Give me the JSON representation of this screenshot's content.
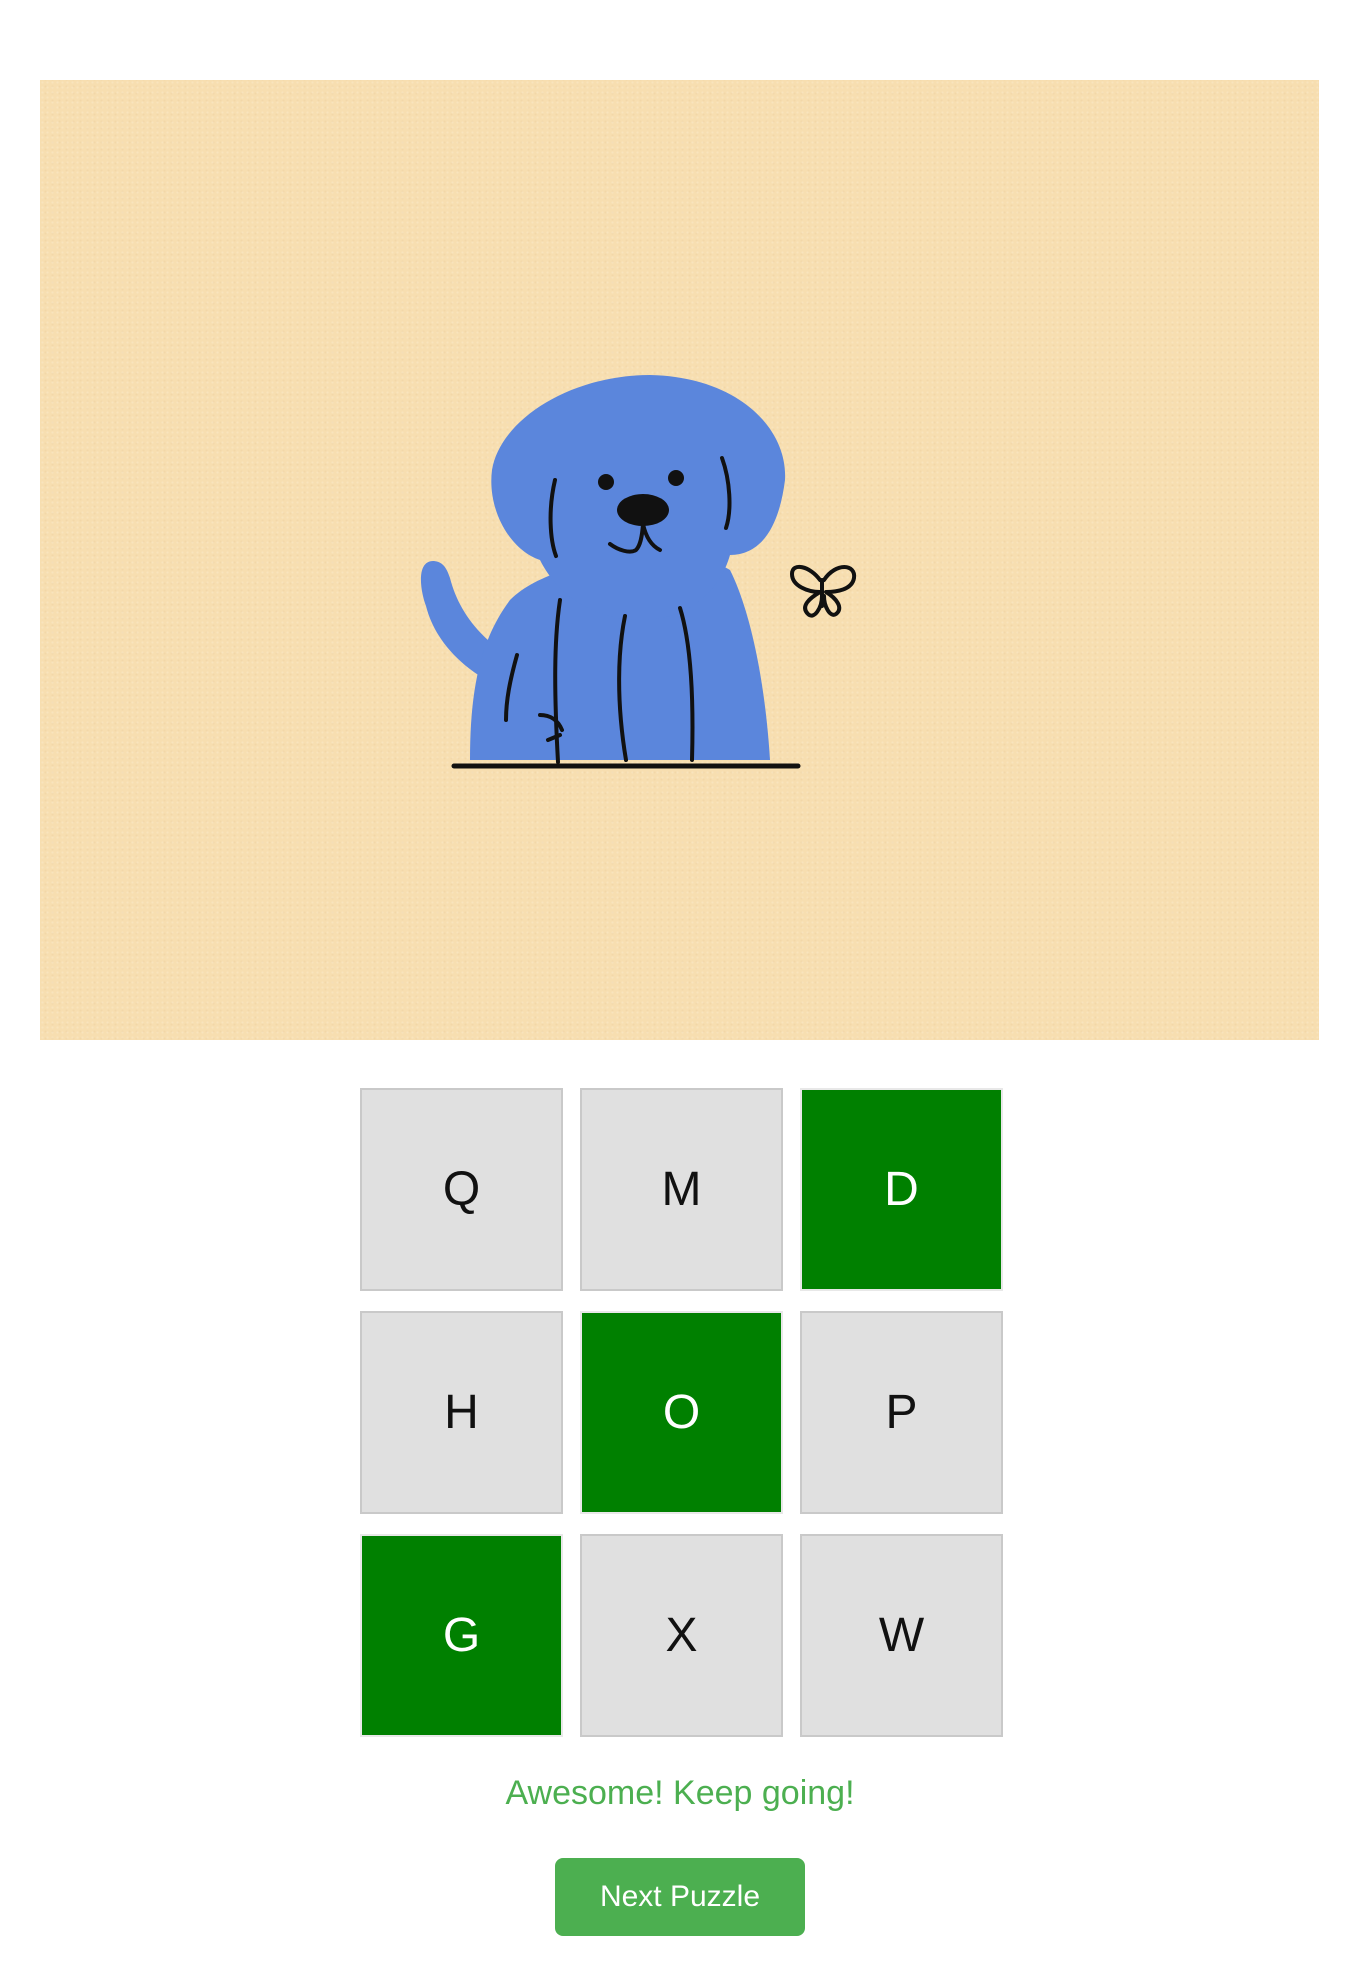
{
  "puzzle": {
    "image_subject": "dog",
    "tiles": [
      {
        "letter": "Q",
        "selected": false
      },
      {
        "letter": "M",
        "selected": false
      },
      {
        "letter": "D",
        "selected": true
      },
      {
        "letter": "H",
        "selected": false
      },
      {
        "letter": "O",
        "selected": true
      },
      {
        "letter": "P",
        "selected": false
      },
      {
        "letter": "G",
        "selected": true
      },
      {
        "letter": "X",
        "selected": false
      },
      {
        "letter": "W",
        "selected": false
      }
    ]
  },
  "feedback": {
    "message": "Awesome! Keep going!"
  },
  "controls": {
    "next_label": "Next Puzzle"
  },
  "colors": {
    "picture_background": "#f7deb0",
    "dog": "#5b86dc",
    "selected_tile": "#008000",
    "unselected_tile": "#e0e0e0",
    "accent_green": "#4caf50"
  }
}
